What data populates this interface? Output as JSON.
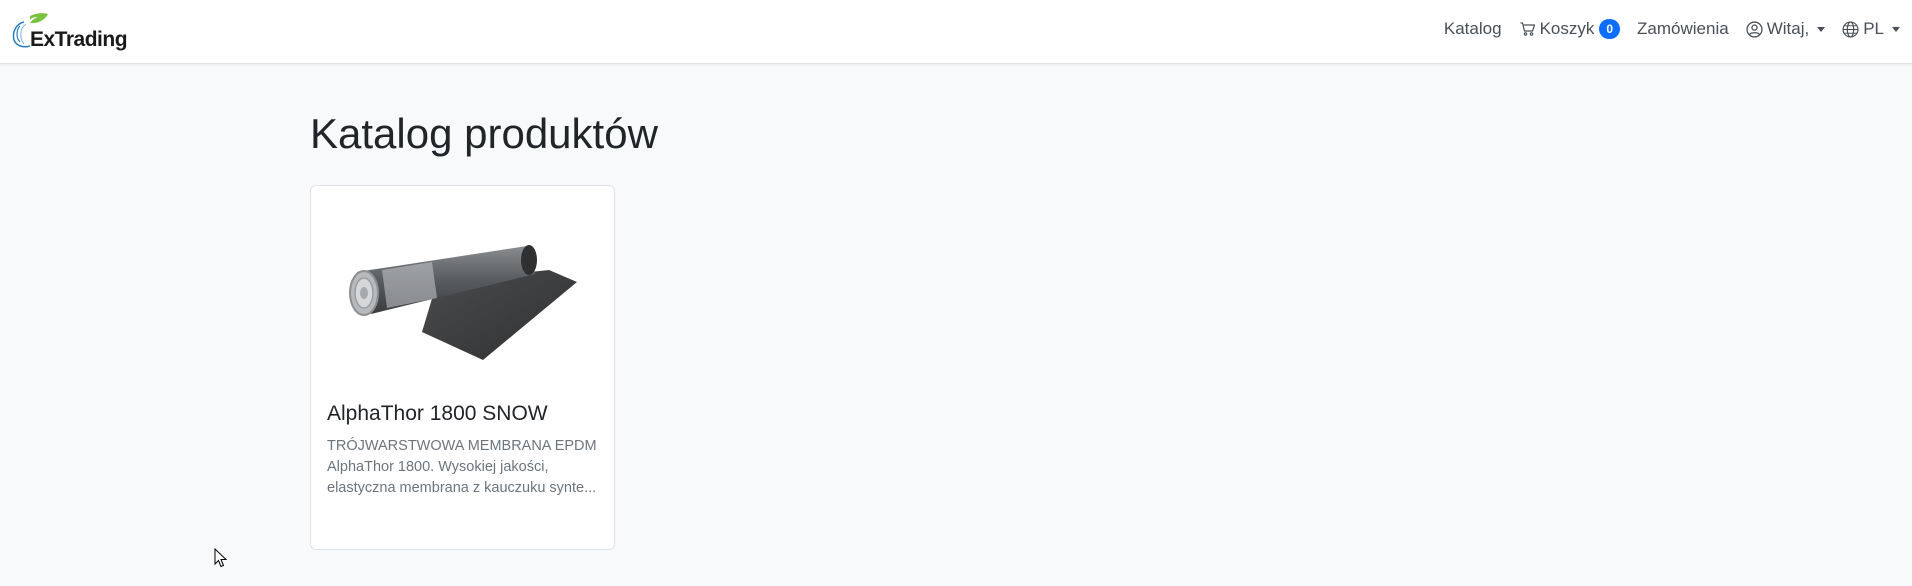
{
  "navbar": {
    "brand": "ExTrading",
    "items": [
      {
        "label": "Katalog"
      },
      {
        "label": "Koszyk",
        "badge": "0"
      },
      {
        "label": "Zamówienia"
      },
      {
        "label": "Witaj,"
      },
      {
        "label": "PL"
      }
    ]
  },
  "main": {
    "title": "Katalog produktów",
    "products": [
      {
        "name": "AlphaThor 1800 SNOW",
        "description": "TRÓJWARSTWOWA MEMBRANA EPDM AlphaThor 1800. Wysokiej jakości, elastyczna membrana z kauczuku synte..."
      }
    ]
  },
  "colors": {
    "accent": "#0d6efd",
    "background": "#f8f9fa",
    "logo_green": "#7cc242",
    "logo_blue": "#2a7fc1"
  },
  "icons": [
    "logo-leaf-icon",
    "cart-icon",
    "user-circle-icon",
    "globe-icon",
    "chevron-down-icon",
    "mouse-cursor-icon"
  ]
}
